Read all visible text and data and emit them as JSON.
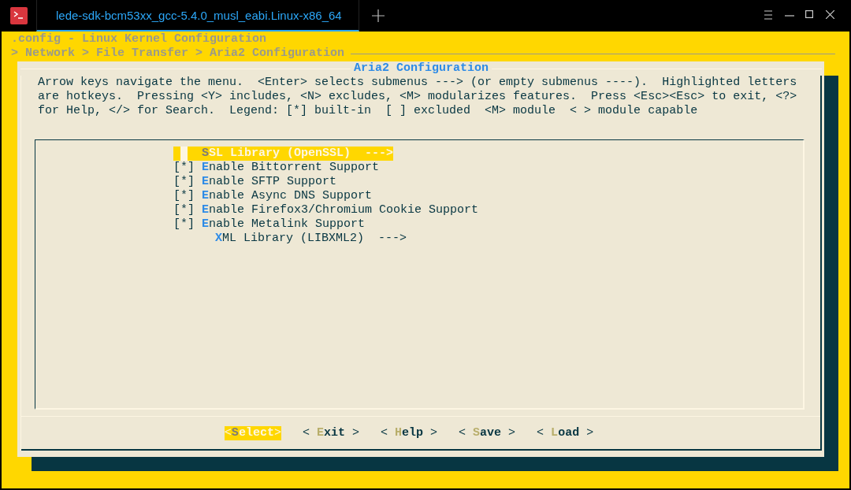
{
  "window": {
    "tab": {
      "title": "lede-sdk-bcm53xx_gcc-5.4.0_musl_eabi.Linux-x86_64",
      "selected": true
    }
  },
  "terminal": {
    "header": ".config - Linux Kernel Configuration",
    "breadcrumb": "> Network > File Transfer > Aria2 Configuration"
  },
  "dialog": {
    "title": "Aria2 Configuration",
    "help": [
      "Arrow keys navigate the menu.  <Enter> selects submenus ---> (or empty submenus ----).  Highlighted letters",
      "are hotkeys.  Pressing <Y> includes, <N> excludes, <M> modularizes features.  Press <Esc><Esc> to exit, <?>",
      "for Help, </> for Search.  Legend: [*] built-in  [ ] excluded  <M> module  < > module capable"
    ],
    "items": [
      {
        "kind": "choice",
        "hotkey": "S",
        "text": "SL Library (OpenSSL)  --->",
        "selected": true
      },
      {
        "kind": "checkbox",
        "box": "[*]",
        "hotkey": "E",
        "text": "nable Bittorrent Support",
        "selected": false
      },
      {
        "kind": "checkbox",
        "box": "[*]",
        "hotkey": "E",
        "text": "nable SFTP Support",
        "selected": false
      },
      {
        "kind": "checkbox",
        "box": "[*]",
        "hotkey": "E",
        "text": "nable Async DNS Support",
        "selected": false
      },
      {
        "kind": "checkbox",
        "box": "[*]",
        "hotkey": "E",
        "text": "nable Firefox3/Chromium Cookie Support",
        "selected": false
      },
      {
        "kind": "checkbox",
        "box": "[*]",
        "hotkey": "E",
        "text": "nable Metalink Support",
        "selected": false
      },
      {
        "kind": "submenu",
        "hotkey": "X",
        "text": "ML Library (LIBXML2)  --->",
        "selected": false
      }
    ],
    "buttons": [
      {
        "open": "<",
        "hotkey": "S",
        "text": "elect",
        "close": ">",
        "selected": true
      },
      {
        "open": "< ",
        "hotkey": "E",
        "text": "xit",
        "close": " >",
        "selected": false
      },
      {
        "open": "< ",
        "hotkey": "H",
        "text": "elp",
        "close": " >",
        "selected": false
      },
      {
        "open": "< ",
        "hotkey": "S",
        "text": "ave",
        "close": " >",
        "selected": false
      },
      {
        "open": "< ",
        "hotkey": "L",
        "text": "oad",
        "close": " >",
        "selected": false
      }
    ]
  }
}
